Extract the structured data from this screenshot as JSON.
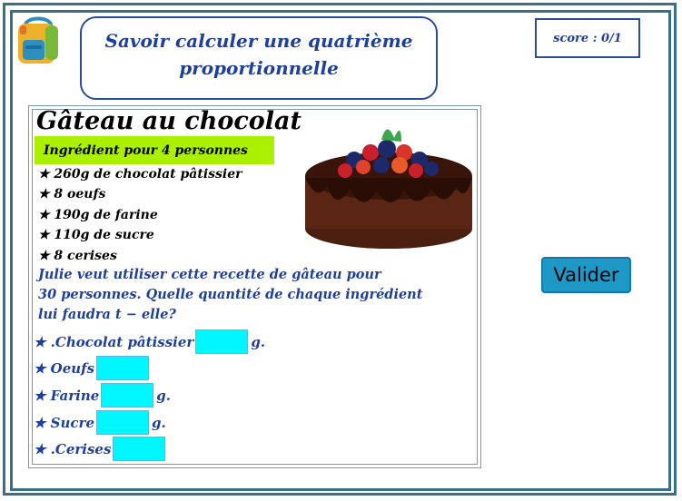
{
  "header": {
    "title_line1": "Savoir calculer une quatrième",
    "title_line2": "proportionnelle",
    "score": "score : 0/1"
  },
  "recipe": {
    "title": "Gâteau au chocolat",
    "subtitle": "Ingrédient pour 4 personnes",
    "ingredients": [
      "★ 260g de chocolat pâtissier",
      "★ 8 oeufs",
      "★ 190g de farine",
      "★ 110g de sucre",
      "★ 8 cerises"
    ],
    "question_line1": "Julie veut utiliser cette recette de gâteau pour",
    "question_line2": "30 personnes. Quelle quantité de chaque ingrédient",
    "question_line3": "lui faudra t − elle?"
  },
  "answers": [
    {
      "label": "★ .Chocolat pâtissier",
      "unit": "g.",
      "value": ""
    },
    {
      "label": "★ Oeufs",
      "unit": "",
      "value": ""
    },
    {
      "label": "★ Farine",
      "unit": "g.",
      "value": ""
    },
    {
      "label": "★ Sucre",
      "unit": "g.",
      "value": ""
    },
    {
      "label": "★ .Cerises",
      "unit": "",
      "value": ""
    }
  ],
  "buttons": {
    "validate": "Valider"
  },
  "icons": {
    "logo": "backpack-icon",
    "cake": "chocolate-cake-image"
  },
  "colors": {
    "frame": "#3b6e87",
    "title_text": "#1f3f9d",
    "highlight": "#aaf000",
    "input_bg": "#00f7ff",
    "button_bg": "#1e98c6"
  }
}
